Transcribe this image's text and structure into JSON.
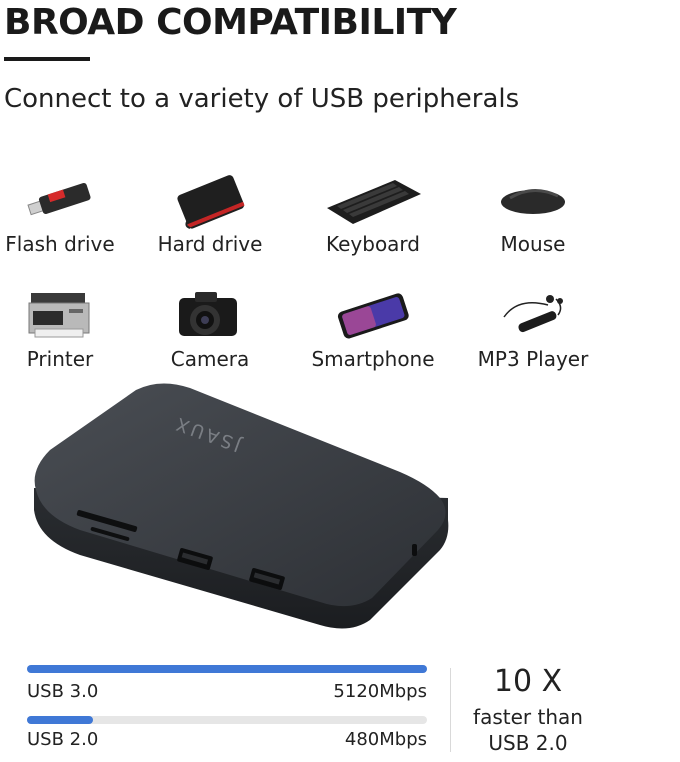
{
  "header": {
    "title": "BROAD COMPATIBILITY",
    "subtitle": "Connect to a variety of USB peripherals"
  },
  "devices": [
    {
      "label": "Flash drive",
      "icon": "flash-drive-icon"
    },
    {
      "label": "Hard drive",
      "icon": "hard-drive-icon"
    },
    {
      "label": "Keyboard",
      "icon": "keyboard-icon"
    },
    {
      "label": "Mouse",
      "icon": "mouse-icon"
    },
    {
      "label": "Printer",
      "icon": "printer-icon"
    },
    {
      "label": "Camera",
      "icon": "camera-icon"
    },
    {
      "label": "Smartphone",
      "icon": "smartphone-icon"
    },
    {
      "label": "MP3 Player",
      "icon": "mp3-player-icon"
    }
  ],
  "product": {
    "brand": "JSAUX"
  },
  "speed": {
    "usb3": {
      "label": "USB 3.0",
      "value": "5120Mbps",
      "fill_fraction": 1.0
    },
    "usb2": {
      "label": "USB 2.0",
      "value": "480Mbps",
      "fill_fraction": 0.165
    },
    "multiplier": "10 X",
    "line1": "faster than",
    "line2": "USB 2.0"
  },
  "colors": {
    "accent": "#3f78d6",
    "track": "#e6e6e6",
    "text": "#222222"
  }
}
